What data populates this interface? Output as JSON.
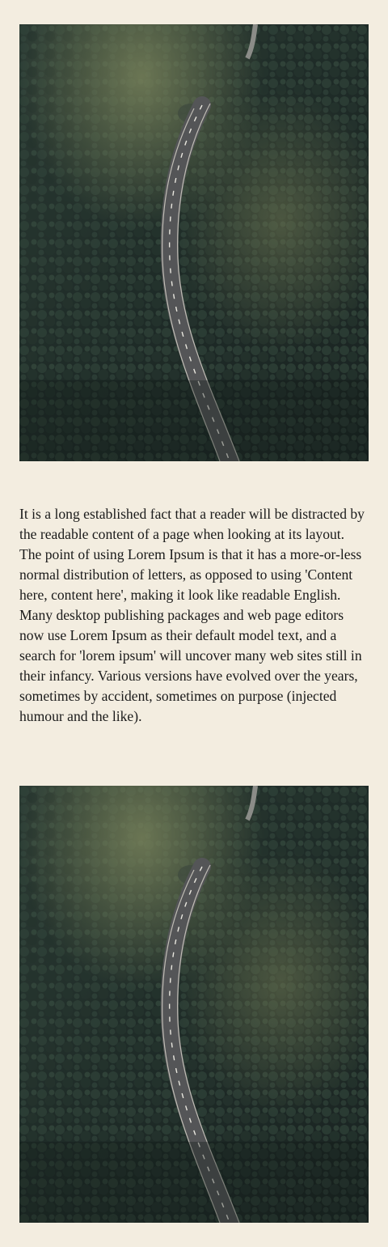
{
  "article": {
    "paragraph": "It is a long established fact that a reader will be distracted by the readable content of a page when looking at its layout. The point of using Lorem Ipsum is that it has a more-or-less normal distribution of letters, as opposed to using 'Content here, content here', making it look like readable English. Many desktop publishing packages and web page editors now use Lorem Ipsum as their default model text, and a search for 'lorem ipsum' will uncover many web sites still in their infancy. Various versions have evolved over the years, sometimes by accident, sometimes on purpose (injected humour and the like)."
  },
  "images": [
    {
      "name": "forest-road-photo-top",
      "depicts": "aerial view of a winding road through a dense pine forest"
    },
    {
      "name": "forest-road-photo-bottom",
      "depicts": "aerial view of a winding road through a dense pine forest"
    }
  ],
  "colors": {
    "page_background": "#f3ede0",
    "text": "#1b1b1b",
    "forest_dark": "#1f2a27",
    "forest_light": "#5f6d4f",
    "road": "#5c5c5e",
    "road_line": "#e9e7df"
  }
}
